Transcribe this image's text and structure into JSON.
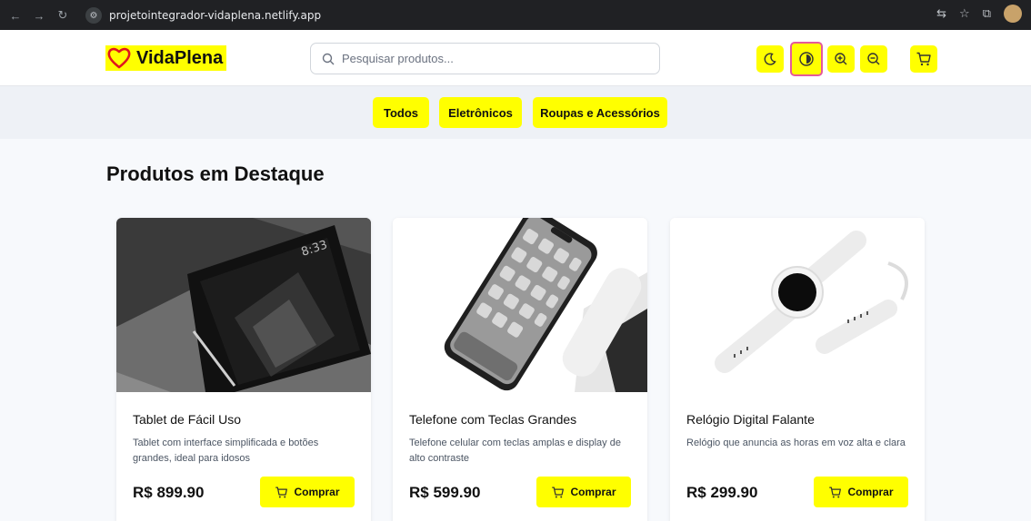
{
  "browser": {
    "url": "projetointegrador-vidaplena.netlify.app"
  },
  "header": {
    "brand": "VidaPlena",
    "search_placeholder": "Pesquisar produtos...",
    "tools": [
      "moon-icon",
      "contrast-icon",
      "zoom-in-icon",
      "zoom-out-icon",
      "cart-icon"
    ]
  },
  "categories": [
    "Todos",
    "Eletrônicos",
    "Roupas e Acessórios"
  ],
  "section_title": "Produtos em Destaque",
  "products": [
    {
      "name": "Tablet de Fácil Uso",
      "description": "Tablet com interface simplificada e botões grandes, ideal para idosos",
      "price": "R$ 899.90",
      "button": "Comprar"
    },
    {
      "name": "Telefone com Teclas Grandes",
      "description": "Telefone celular com teclas amplas e display de alto contraste",
      "price": "R$ 599.90",
      "button": "Comprar"
    },
    {
      "name": "Relógio Digital Falante",
      "description": "Relógio que anuncia as horas em voz alta e clara",
      "price": "R$ 299.90",
      "button": "Comprar"
    }
  ],
  "colors": {
    "accent": "#ffff00",
    "contrast_outline": "#e5599a"
  }
}
